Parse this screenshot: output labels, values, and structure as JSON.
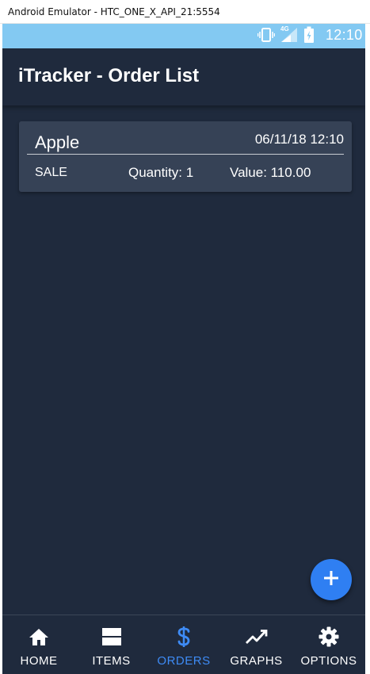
{
  "window": {
    "title": "Android Emulator - HTC_ONE_X_API_21:5554"
  },
  "status_bar": {
    "time": "12:10",
    "network_label": "4G",
    "icons": [
      "vibrate-icon",
      "signal-icon",
      "battery-icon"
    ]
  },
  "app_bar": {
    "title": "iTracker - Order List"
  },
  "orders": [
    {
      "item": "Apple",
      "datetime": "06/11/18 12:10",
      "type": "SALE",
      "quantity": "Quantity: 1",
      "value": "Value: 110.00"
    }
  ],
  "fab": {
    "icon": "plus-icon"
  },
  "bottom_nav": {
    "active": "orders",
    "items": [
      {
        "label": "HOME",
        "icon": "home-icon"
      },
      {
        "label": "ITEMS",
        "icon": "list-icon"
      },
      {
        "label": "ORDERS",
        "icon": "dollar-icon"
      },
      {
        "label": "GRAPHS",
        "icon": "trending-icon"
      },
      {
        "label": "OPTIONS",
        "icon": "gear-icon"
      }
    ]
  },
  "colors": {
    "background": "#1f2a3d",
    "card": "#364256",
    "accent": "#2f7ff2",
    "active_nav": "#3e8bf5",
    "status_bar": "#83c9f2"
  }
}
